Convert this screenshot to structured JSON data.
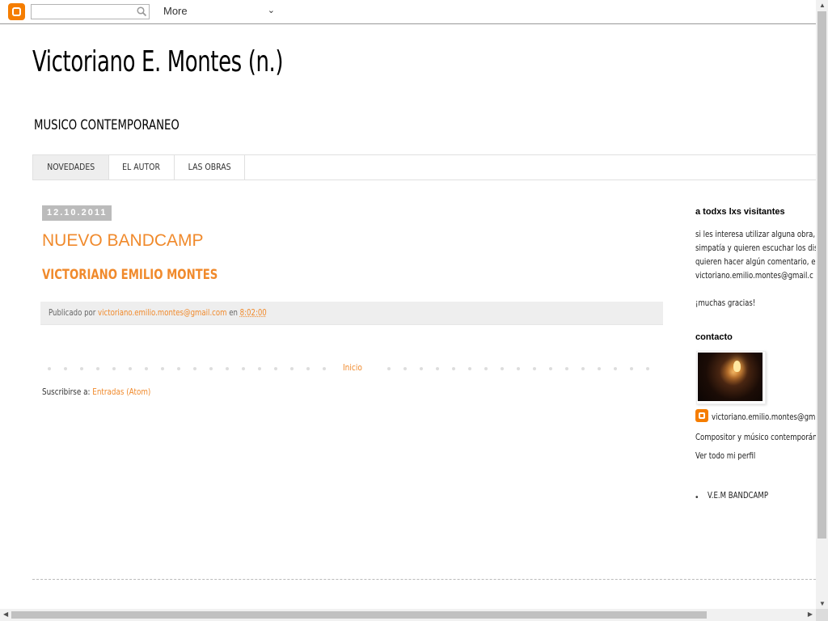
{
  "navbar": {
    "search_placeholder": "",
    "more_label": "More"
  },
  "header": {
    "title": "Victoriano E. Montes (n.)",
    "description": "MUSICO CONTEMPORANEO"
  },
  "tabs": [
    {
      "label": "NOVEDADES",
      "active": true
    },
    {
      "label": "EL AUTOR",
      "active": false
    },
    {
      "label": "LAS OBRAS",
      "active": false
    }
  ],
  "post": {
    "date": "12.10.2011",
    "title": "NUEVO BANDCAMP",
    "body": "VICTORIANO EMILIO MONTES",
    "footer": {
      "published_by": "Publicado por",
      "author": "victoriano.emilio.montes@gmail.com",
      "en": "en",
      "time": "8:02:00"
    }
  },
  "pager": {
    "home_label": "Inicio"
  },
  "subscribe": {
    "prefix": "Suscribirse a:",
    "link": "Entradas (Atom)"
  },
  "sidebar": {
    "visitors": {
      "title": "a todxs lxs visitantes",
      "lines": [
        "si les interesa utilizar alguna obra, s",
        "simpatía y quieren escuchar los disc",
        "quieren hacer algún comentario, esc",
        "victoriano.emilio.montes@gmail.c"
      ],
      "thanks": "¡muchas gracias!"
    },
    "contact": {
      "title": "contacto",
      "profile_name": "victoriano.emilio.montes@gm",
      "profile_desc": "Compositor y músico contemporánec",
      "profile_link": "Ver todo mi perfil"
    },
    "links": [
      "V.E.M BANDCAMP"
    ]
  },
  "colors": {
    "accent": "#f08a2c",
    "blogger_orange": "#f57d00",
    "date_bg": "#bbbbbb"
  }
}
